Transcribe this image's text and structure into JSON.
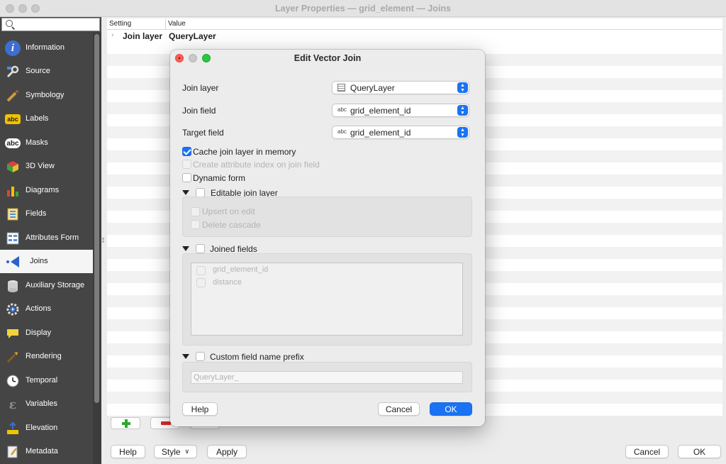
{
  "window": {
    "title": "Layer Properties — grid_element — Joins"
  },
  "sidebar": {
    "search_value": "",
    "items": [
      {
        "label": "Information",
        "icon": "info-icon",
        "color": "#3d6fd1"
      },
      {
        "label": "Source",
        "icon": "source-wrench-icon",
        "color": "#7a7a7a"
      },
      {
        "label": "Symbology",
        "icon": "symbology-brush-icon",
        "color": "#d19a3a"
      },
      {
        "label": "Labels",
        "icon": "labels-abc-icon",
        "color": "#f2c200"
      },
      {
        "label": "Masks",
        "icon": "masks-abc-icon",
        "color": "#ffffff"
      },
      {
        "label": "3D View",
        "icon": "3d-cube-icon",
        "color": "#4aa84a"
      },
      {
        "label": "Diagrams",
        "icon": "diagrams-icon",
        "color": "#d13b3b"
      },
      {
        "label": "Fields",
        "icon": "fields-icon",
        "color": "#e6c94a"
      },
      {
        "label": "Attributes Form",
        "icon": "attributes-form-icon",
        "color": "#5a8fd6"
      },
      {
        "label": "Joins",
        "icon": "joins-icon",
        "color": "#2a62c7"
      },
      {
        "label": "Auxiliary Storage",
        "icon": "auxiliary-storage-icon",
        "color": "#cfcfcf"
      },
      {
        "label": "Actions",
        "icon": "actions-gear-icon",
        "color": "#3a6fd0"
      },
      {
        "label": "Display",
        "icon": "display-bubble-icon",
        "color": "#f2d33a"
      },
      {
        "label": "Rendering",
        "icon": "rendering-brush-icon",
        "color": "#e0a030"
      },
      {
        "label": "Temporal",
        "icon": "temporal-clock-icon",
        "color": "#ffffff"
      },
      {
        "label": "Variables",
        "icon": "variables-epsilon-icon",
        "color": "#8c8c8c"
      },
      {
        "label": "Elevation",
        "icon": "elevation-icon",
        "color": "#f2c200"
      },
      {
        "label": "Metadata",
        "icon": "metadata-icon",
        "color": "#e6e6e6"
      }
    ],
    "active_label": "Joins"
  },
  "tree": {
    "col_setting": "Setting",
    "col_value": "Value",
    "row_key": "Join layer",
    "row_value": "QueryLayer"
  },
  "footer": {
    "help": "Help",
    "style": "Style",
    "apply": "Apply",
    "cancel": "Cancel",
    "ok": "OK"
  },
  "dialog": {
    "title": "Edit Vector Join",
    "join_layer_label": "Join layer",
    "join_layer_value": "QueryLayer",
    "join_field_label": "Join field",
    "join_field_value": "grid_element_id",
    "target_field_label": "Target field",
    "target_field_value": "grid_element_id",
    "field_type_glyph": "abc",
    "cache_label": "Cache join layer in memory",
    "cache_checked": true,
    "create_index_label": "Create attribute index on join field",
    "dynamic_form_label": "Dynamic form",
    "editable_join_label": "Editable join layer",
    "upsert_label": "Upsert on edit",
    "delete_cascade_label": "Delete cascade",
    "joined_fields_label": "Joined fields",
    "joined_fields": [
      "grid_element_id",
      "distance"
    ],
    "prefix_label": "Custom field name prefix",
    "prefix_placeholder": "QueryLayer_",
    "help": "Help",
    "cancel": "Cancel",
    "ok": "OK"
  },
  "colors": {
    "accent": "#1a73f2",
    "sidebar_bg": "#454545"
  }
}
